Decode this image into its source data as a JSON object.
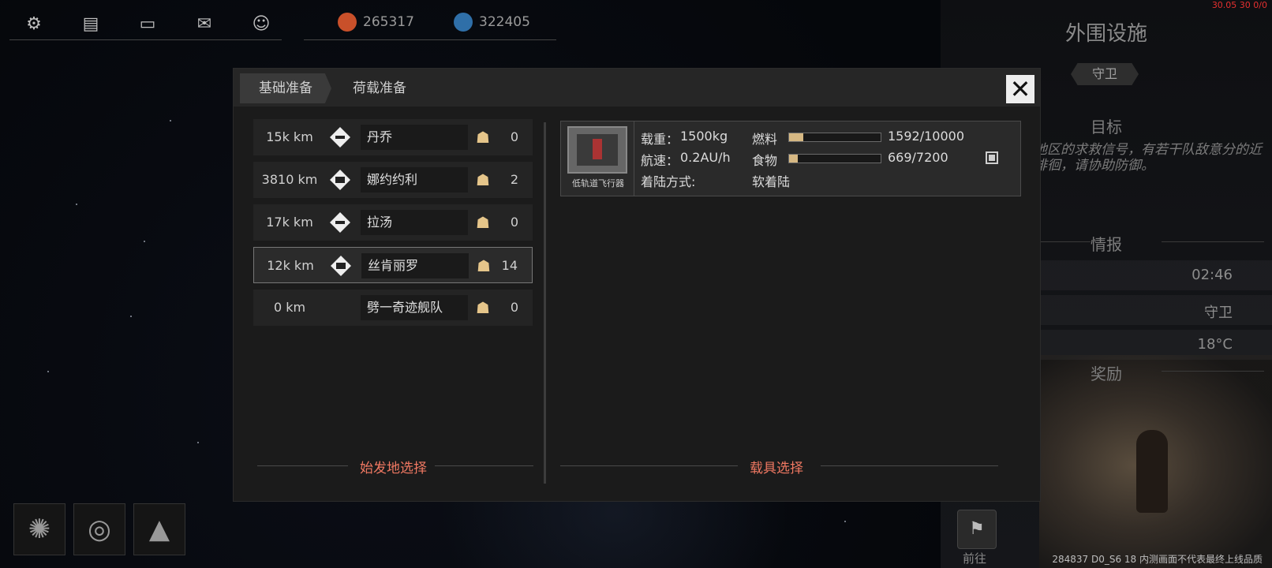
{
  "hud": {
    "icons": [
      "gear-icon",
      "chat-icon",
      "message-icon",
      "mail-icon",
      "contacts-icon"
    ],
    "resources": [
      {
        "icon": "resource-red-icon",
        "value": "265317",
        "color": "#c9502a"
      },
      {
        "icon": "resource-blue-icon",
        "value": "322405",
        "color": "#2f6fa8"
      }
    ],
    "debug_top": "30.05 30 0/0",
    "debug_bottom": "284837 D0_S6 18 内测画面不代表最终上线品质"
  },
  "side_panel": {
    "title": "外围设施",
    "tag": "守卫",
    "goal_heading": "目标",
    "goal_text": "地区的求救信号，有若干队敌意分的近徘徊，请协助防御。",
    "intel_heading": "情报",
    "intel_rows": [
      "02:46",
      "守卫",
      "18°C"
    ],
    "reward_heading": "奖励",
    "go_label": "前往"
  },
  "modal": {
    "tabs": [
      {
        "label": "基础准备",
        "active": true
      },
      {
        "label": "荷载准备",
        "active": false
      }
    ],
    "close_label": "✕",
    "origin_section_label": "始发地选择",
    "vehicle_section_label": "载具选择",
    "destinations": [
      {
        "distance": "15k km",
        "name": "丹乔",
        "population": "0",
        "selected": false,
        "has_icon": true
      },
      {
        "distance": "3810 km",
        "name": "娜约约利",
        "population": "2",
        "selected": false,
        "has_icon": true
      },
      {
        "distance": "17k km",
        "name": "拉汤",
        "population": "0",
        "selected": false,
        "has_icon": true
      },
      {
        "distance": "12k km",
        "name": "丝肯丽罗",
        "population": "14",
        "selected": true,
        "has_icon": true
      },
      {
        "distance": "0 km",
        "name": "劈一奇迹舰队",
        "population": "0",
        "selected": false,
        "has_icon": false
      }
    ],
    "vehicle": {
      "name": "低轨道飞行器",
      "load_label": "载重：",
      "load_value": "1500kg",
      "speed_label": "航速：",
      "speed_value": "0.2AU/h",
      "landing_label": "着陆方式:",
      "landing_value": "软着陆",
      "fuel_label": "燃料",
      "fuel_value": "1592/10000",
      "fuel_fraction": 0.159,
      "food_label": "食物",
      "food_value": "669/7200",
      "food_fraction": 0.093,
      "selected": true
    }
  },
  "bottom_buttons": [
    "galaxy-icon",
    "planet-orbit-icon",
    "terrain-icon"
  ]
}
